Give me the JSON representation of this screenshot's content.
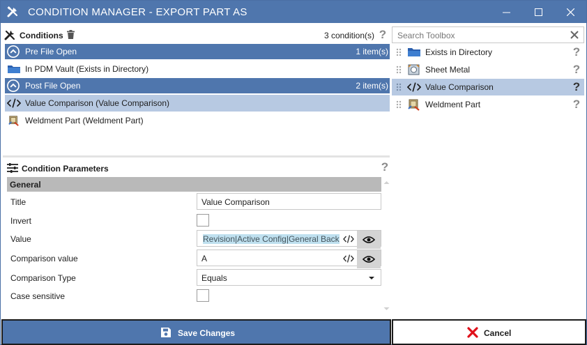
{
  "window": {
    "title": "CONDITION MANAGER - EXPORT PART AS",
    "accent_color": "#4f76ad",
    "selected_color": "#b7c9e2",
    "controls": [
      "minimize-icon",
      "maximize-icon",
      "close-icon"
    ]
  },
  "conditions": {
    "header": "Conditions",
    "count": "3 condition(s)",
    "groups": [
      {
        "label": "Pre File Open",
        "count": "1 item(s)",
        "items": [
          {
            "label": "In PDM Vault (Exists in Directory)",
            "icon": "folder-icon",
            "selected": false
          }
        ]
      },
      {
        "label": "Post File Open",
        "count": "2 item(s)",
        "items": [
          {
            "label": "Value Comparison (Value Comparison)",
            "icon": "code-icon",
            "selected": true
          },
          {
            "label": "Weldment Part (Weldment Part)",
            "icon": "weldment-icon",
            "selected": false
          }
        ]
      }
    ]
  },
  "parameters": {
    "header": "Condition Parameters",
    "section": "General",
    "fields": {
      "title_label": "Title",
      "title_value": "Value Comparison",
      "invert_label": "Invert",
      "value_label": "Value",
      "value_value": "Revision|Active Config|General Backu",
      "comparison_value_label": "Comparison value",
      "comparison_value_value": "A",
      "comparison_type_label": "Comparison Type",
      "comparison_type_value": "Equals",
      "case_sensitive_label": "Case sensitive"
    }
  },
  "toolbox": {
    "search_placeholder": "Search Toolbox",
    "items": [
      {
        "label": "Exists in Directory",
        "icon": "folder-icon",
        "selected": false
      },
      {
        "label": "Sheet Metal",
        "icon": "sheet-metal-icon",
        "selected": false
      },
      {
        "label": "Value Comparison",
        "icon": "code-icon",
        "selected": true
      },
      {
        "label": "Weldment Part",
        "icon": "weldment-icon",
        "selected": false
      }
    ]
  },
  "footer": {
    "save_label": "Save Changes",
    "cancel_label": "Cancel"
  }
}
